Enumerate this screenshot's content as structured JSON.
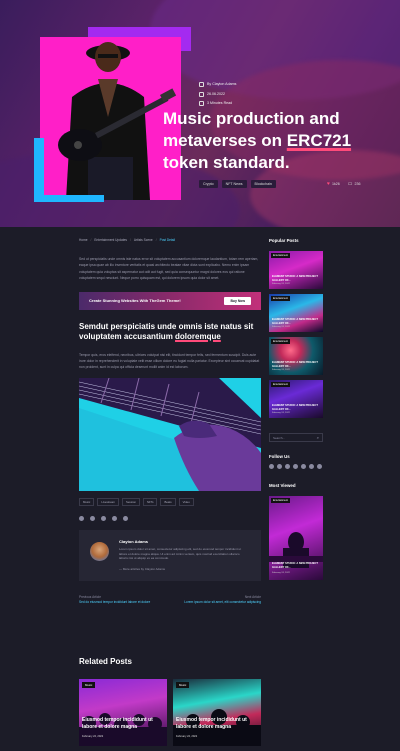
{
  "hero": {
    "author": "By Clayton Adams",
    "date": "26.06.2022",
    "read_time": "3 Minutes Read",
    "title_prefix": "Music production and metaverses on ",
    "title_highlight": "ERC721",
    "title_suffix": " token standard.",
    "tags": [
      "Crypto",
      "NFT News",
      "Blockchain"
    ],
    "likes": "1k26",
    "comments": "236"
  },
  "breadcrumb": [
    "Home",
    "Entertainment Updates",
    "Artists Scene",
    "Post Detail"
  ],
  "intro": "Sed ut perspiciatis unde omnis iste natus error sit voluptatem accusantium doloremque laudantium, totam rem aperiam, eaque ipsa quae ab illo inventore veritatis et quasi architecto beatae vitae dicta sunt explicabo. Nemo enim ipsam voluptatem quia voluptas sit aspernatur aut odit aut fugit, sed quia consequuntur magni dolores eos qui ratione voluptatem sequi nesciunt. Neque porro quisquam est, qui dolorem ipsum quia dolor sit amet.",
  "cta": {
    "text": "Create Stunning Websites With TheGem Theme!",
    "button": "Buy Now"
  },
  "subheading_prefix": "Semdut perspiciatis unde omnis iste natus sit voluptatem accusantium ",
  "subheading_highlight": "doloremque",
  "body": "Tempor quis, eros eleifend, necribus, ultrices volutpat nisi elit, tincidunt tempor felis, sed fermentum suscipit. Duis aute irure dolor in reprehenderit in voluptate velit esse cillum dolore eu fugiat nulla pariatur. Excepteur sint occaecat cupidatat non proident, sunt in culpa qui officia deserunt mollit anim id est laborum.",
  "content_tags": [
    "Music",
    "Livestream",
    "Session",
    "NFTs",
    "Beats",
    "Video"
  ],
  "author_box": {
    "name": "Clayton Adams",
    "bio": "Lorem ipsum dolor sit amet, consectetur adipiscing elit, sed do eiusmod tempor incididunt ut labore et dolore magna aliqua. Ut enim ad minim veniam, quis nostrud exercitation ullamco laboris nisi ut aliquip ex ea commodo.",
    "link": "— More articles by Clayton Adams"
  },
  "post_nav": {
    "prev_label": "Previous Article",
    "prev_title": "Sed do eiusmod tempor incididunt labore et dolore",
    "next_label": "Next Article",
    "next_title": "Lorem ipsum dolor sit amet, elit consectetur adipiscing"
  },
  "related": {
    "heading": "Related Posts",
    "posts": [
      {
        "cat": "Music",
        "title": "Eiusmod tempor incididunt ut labore et dolore magna",
        "date": "February 24, 2022"
      },
      {
        "cat": "Music",
        "title": "Eiusmod tempor incididunt ut labore et dolore magna",
        "date": "February 24, 2022"
      }
    ]
  },
  "sidebar": {
    "popular_heading": "Popular Posts",
    "popular": [
      {
        "cat": "Entertainment",
        "title": "ELEMENT STUDIO: A NEW PROJECT GALLERY OF...",
        "date": "February 24, 2022"
      },
      {
        "cat": "Entertainment",
        "title": "ELEMENT STUDIO: A NEW PROJECT GALLERY OF...",
        "date": "February 24, 2022"
      },
      {
        "cat": "Entertainment",
        "title": "ELEMENT STUDIO: A NEW PROJECT GALLERY OF...",
        "date": "February 24, 2022"
      },
      {
        "cat": "Entertainment",
        "title": "ELEMENT STUDIO: A NEW PROJECT GALLERY OF...",
        "date": "February 24, 2022"
      }
    ],
    "search_placeholder": "Search...",
    "follow_heading": "Follow Us",
    "viewed_heading": "Most Viewed",
    "viewed": {
      "cat": "Entertainment",
      "title": "ELEMENT STUDIO: A NEW PROJECT GALLERY OF...",
      "date": "February 24, 2022"
    }
  },
  "colors": {
    "accent": "#4dd3ff",
    "highlight": "#ff4a7a",
    "background": "#1c1c28"
  },
  "icons": [
    "user-icon",
    "calendar-icon",
    "clock-icon",
    "heart-icon",
    "comment-icon",
    "search-icon",
    "twitter-icon",
    "facebook-icon",
    "youtube-icon",
    "instagram-icon",
    "linkedin-icon"
  ]
}
